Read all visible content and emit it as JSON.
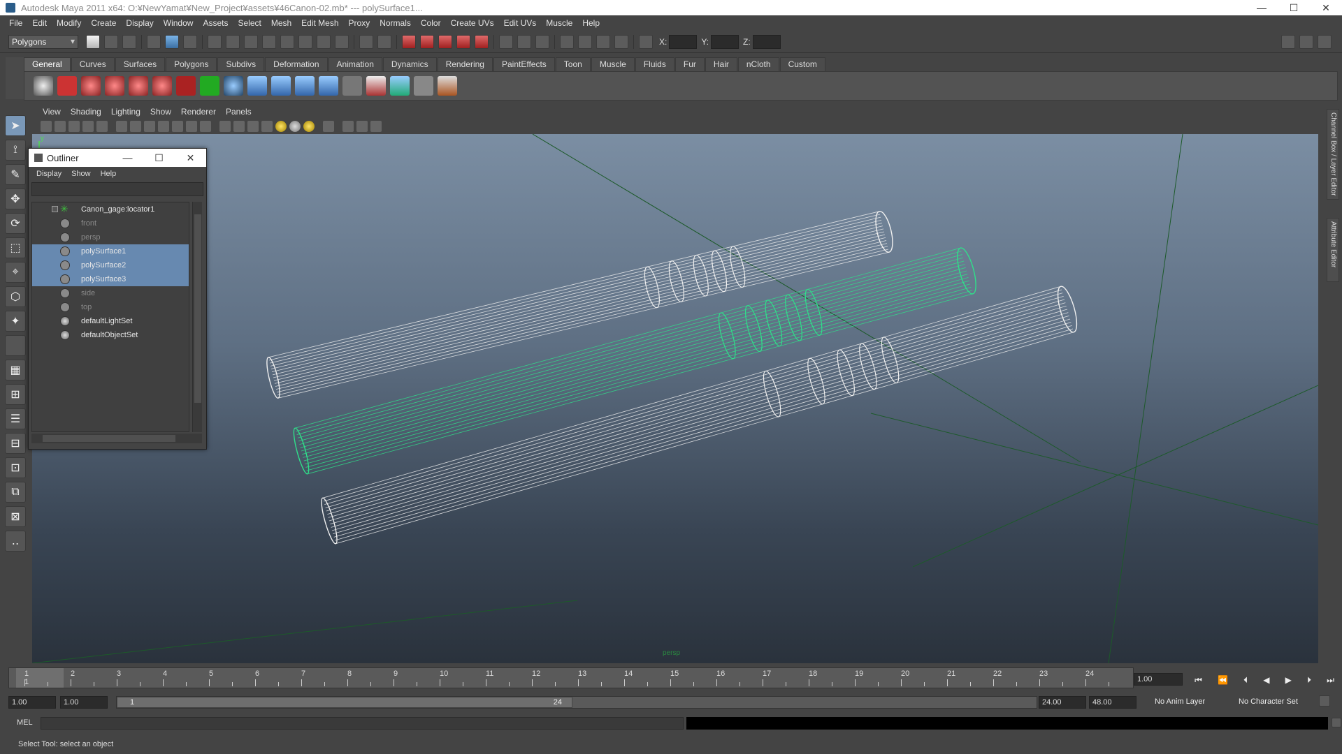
{
  "window": {
    "title": "Autodesk Maya 2011 x64: O:¥NewYamat¥New_Project¥assets¥46Canon-02.mb*  ---  polySurface1...",
    "minimize": "—",
    "maximize": "☐",
    "close": "✕"
  },
  "menubar": [
    "File",
    "Edit",
    "Modify",
    "Create",
    "Display",
    "Window",
    "Assets",
    "Select",
    "Mesh",
    "Edit Mesh",
    "Proxy",
    "Normals",
    "Color",
    "Create UVs",
    "Edit UVs",
    "Muscle",
    "Help"
  ],
  "statusline": {
    "mode": "Polygons",
    "x_label": "X:",
    "y_label": "Y:",
    "z_label": "Z:"
  },
  "shelf": {
    "tabs": [
      "General",
      "Curves",
      "Surfaces",
      "Polygons",
      "Subdivs",
      "Deformation",
      "Animation",
      "Dynamics",
      "Rendering",
      "PaintEffects",
      "Toon",
      "Muscle",
      "Fluids",
      "Fur",
      "Hair",
      "nCloth",
      "Custom"
    ],
    "active_tab": "General"
  },
  "viewport": {
    "menus": [
      "View",
      "Shading",
      "Lighting",
      "Show",
      "Renderer",
      "Panels"
    ],
    "camera_label": "persp",
    "axis_y": "y"
  },
  "right_tabs": {
    "channel_box": "Channel Box / Layer Editor",
    "attribute_editor": "Attribute Editor"
  },
  "outliner": {
    "title": "Outliner",
    "menus": [
      "Display",
      "Show",
      "Help"
    ],
    "items": [
      {
        "name": "Canon_gage:locator1",
        "icon": "locator-icon"
      },
      {
        "name": "front",
        "icon": "camera-icon"
      },
      {
        "name": "persp",
        "icon": "camera-icon"
      },
      {
        "name": "polySurface1",
        "icon": "mesh-icon"
      },
      {
        "name": "polySurface2",
        "icon": "mesh-icon"
      },
      {
        "name": "polySurface3",
        "icon": "mesh-icon"
      },
      {
        "name": "side",
        "icon": "camera-icon"
      },
      {
        "name": "top",
        "icon": "camera-icon"
      },
      {
        "name": "defaultLightSet",
        "icon": "set-icon"
      },
      {
        "name": "defaultObjectSet",
        "icon": "set-icon"
      }
    ]
  },
  "timeslider": {
    "ticks": [
      "1",
      "2",
      "3",
      "4",
      "5",
      "6",
      "7",
      "8",
      "9",
      "10",
      "11",
      "12",
      "13",
      "14",
      "15",
      "16",
      "17",
      "18",
      "19",
      "20",
      "21",
      "22",
      "23",
      "24"
    ],
    "current_frame_marker": "1",
    "current_frame_field": "1.00"
  },
  "range": {
    "anim_start": "1.00",
    "playback_start": "1.00",
    "slider_lo": "1",
    "slider_hi": "24",
    "playback_end": "24.00",
    "anim_end": "48.00",
    "anim_layer": "No Anim Layer",
    "character_set": "No Character Set"
  },
  "cmdline": {
    "label": "MEL"
  },
  "helpline": {
    "text": "Select Tool: select an object"
  },
  "colors": {
    "selected_row": "#6789b0",
    "selected_wire": "#2fe08a",
    "wire": "#f0f0f0"
  }
}
